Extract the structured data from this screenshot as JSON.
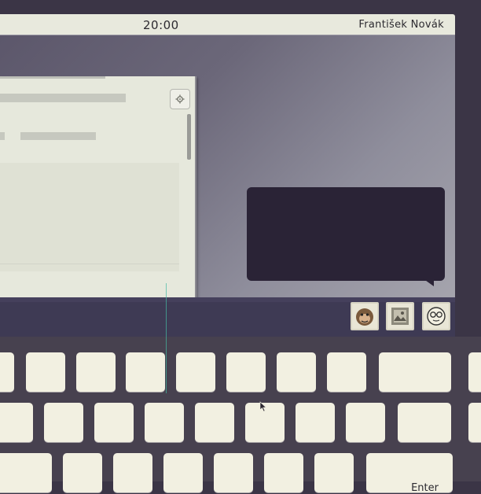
{
  "topbar": {
    "clock": "20:00",
    "user_name": "František Novák"
  },
  "window": {
    "gear_icon": "gear-icon"
  },
  "tray": [
    {
      "name": "monkey-avatar-icon"
    },
    {
      "name": "photo-avatar-icon"
    },
    {
      "name": "glasses-face-icon"
    }
  ],
  "keyboard": {
    "enter_label": "Enter"
  },
  "colors": {
    "accent": "#45b9a2",
    "taskbar": "#3e3a54",
    "bubble": "#2a2336"
  }
}
